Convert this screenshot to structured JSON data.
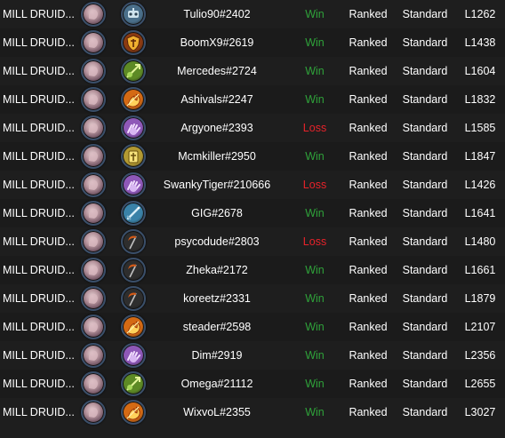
{
  "colors": {
    "background": "#1e1e1e",
    "text": "#ffffff",
    "win": "#2fa23a",
    "loss": "#e8222a"
  },
  "games": [
    {
      "deck": "MILL DRUID...",
      "hero_icon": "druid-portrait-icon",
      "opponent_icon": "mech-class-icon",
      "opponent_color": "#4a6f8a",
      "player": "Tulio90#2402",
      "result": "Win",
      "mode": "Ranked",
      "format": "Standard",
      "rank": "L1262"
    },
    {
      "deck": "MILL DRUID...",
      "hero_icon": "druid-portrait-icon",
      "opponent_icon": "warrior-shield-icon",
      "opponent_color": "#8a3a12",
      "player": "BoomX9#2619",
      "result": "Win",
      "mode": "Ranked",
      "format": "Standard",
      "rank": "L1438"
    },
    {
      "deck": "MILL DRUID...",
      "hero_icon": "druid-portrait-icon",
      "opponent_icon": "hunter-class-icon",
      "opponent_color": "#5d8a25",
      "player": "Mercedes#2724",
      "result": "Win",
      "mode": "Ranked",
      "format": "Standard",
      "rank": "L1604"
    },
    {
      "deck": "MILL DRUID...",
      "hero_icon": "druid-portrait-icon",
      "opponent_icon": "mage-fire-icon",
      "opponent_color": "#d46a14",
      "player": "Ashivals#2247",
      "result": "Win",
      "mode": "Ranked",
      "format": "Standard",
      "rank": "L1832"
    },
    {
      "deck": "MILL DRUID...",
      "hero_icon": "druid-portrait-icon",
      "opponent_icon": "priest-hand-icon",
      "opponent_color": "#8e58b8",
      "player": "Argyone#2393",
      "result": "Loss",
      "mode": "Ranked",
      "format": "Standard",
      "rank": "L1585"
    },
    {
      "deck": "MILL DRUID...",
      "hero_icon": "druid-portrait-icon",
      "opponent_icon": "paladin-class-icon",
      "opponent_color": "#b39a32",
      "player": "Mcmkiller#2950",
      "result": "Win",
      "mode": "Ranked",
      "format": "Standard",
      "rank": "L1847"
    },
    {
      "deck": "MILL DRUID...",
      "hero_icon": "druid-portrait-icon",
      "opponent_icon": "priest-hand-icon",
      "opponent_color": "#8e58b8",
      "player": "SwankyTiger#210666",
      "result": "Loss",
      "mode": "Ranked",
      "format": "Standard",
      "rank": "L1426"
    },
    {
      "deck": "MILL DRUID...",
      "hero_icon": "druid-portrait-icon",
      "opponent_icon": "sword-class-icon",
      "opponent_color": "#3a82a8",
      "player": "GIG#2678",
      "result": "Win",
      "mode": "Ranked",
      "format": "Standard",
      "rank": "L1641"
    },
    {
      "deck": "MILL DRUID...",
      "hero_icon": "druid-portrait-icon",
      "opponent_icon": "scythe-class-icon",
      "opponent_color": "#2e2e2e",
      "player": "psycodude#2803",
      "result": "Loss",
      "mode": "Ranked",
      "format": "Standard",
      "rank": "L1480"
    },
    {
      "deck": "MILL DRUID...",
      "hero_icon": "druid-portrait-icon",
      "opponent_icon": "scythe-class-icon",
      "opponent_color": "#2e2e2e",
      "player": "Zheka#2172",
      "result": "Win",
      "mode": "Ranked",
      "format": "Standard",
      "rank": "L1661"
    },
    {
      "deck": "MILL DRUID...",
      "hero_icon": "druid-portrait-icon",
      "opponent_icon": "scythe-class-icon",
      "opponent_color": "#2e2e2e",
      "player": "koreetz#2331",
      "result": "Win",
      "mode": "Ranked",
      "format": "Standard",
      "rank": "L1879"
    },
    {
      "deck": "MILL DRUID...",
      "hero_icon": "druid-portrait-icon",
      "opponent_icon": "mage-fire-icon",
      "opponent_color": "#d46a14",
      "player": "steader#2598",
      "result": "Win",
      "mode": "Ranked",
      "format": "Standard",
      "rank": "L2107"
    },
    {
      "deck": "MILL DRUID...",
      "hero_icon": "druid-portrait-icon",
      "opponent_icon": "priest-hand-icon",
      "opponent_color": "#8e58b8",
      "player": "Dim#2919",
      "result": "Win",
      "mode": "Ranked",
      "format": "Standard",
      "rank": "L2356"
    },
    {
      "deck": "MILL DRUID...",
      "hero_icon": "druid-portrait-icon",
      "opponent_icon": "hunter-class-icon",
      "opponent_color": "#5d8a25",
      "player": "Omega#21112",
      "result": "Win",
      "mode": "Ranked",
      "format": "Standard",
      "rank": "L2655"
    },
    {
      "deck": "MILL DRUID...",
      "hero_icon": "druid-portrait-icon",
      "opponent_icon": "mage-fire-icon",
      "opponent_color": "#d46a14",
      "player": "WixvoL#2355",
      "result": "Win",
      "mode": "Ranked",
      "format": "Standard",
      "rank": "L3027"
    }
  ]
}
